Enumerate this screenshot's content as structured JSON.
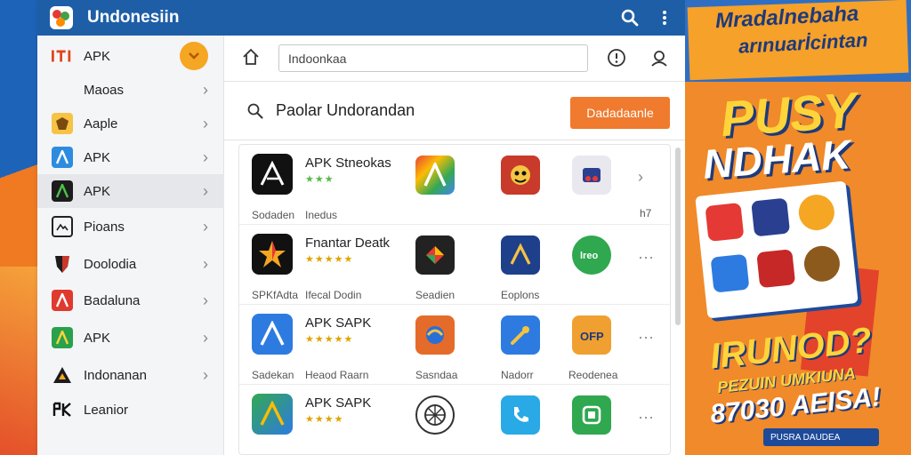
{
  "window": {
    "title": "Undonesiin"
  },
  "toolbar": {
    "address_value": "Indoonkaa"
  },
  "search": {
    "text": "Paolar Undorandan",
    "button_label": "Dadadaanle"
  },
  "sidebar": {
    "items": [
      {
        "label": "APK"
      },
      {
        "label": "Maoas"
      },
      {
        "label": "Aaple"
      },
      {
        "label": "APK"
      },
      {
        "label": "APK"
      },
      {
        "label": "Pioans"
      },
      {
        "label": "Doolodia"
      },
      {
        "label": "Badaluna"
      },
      {
        "label": "APK"
      },
      {
        "label": "Indonanan"
      },
      {
        "label": "Leanior"
      }
    ]
  },
  "rows": [
    {
      "title": "APK Stneokas",
      "stars": "★★★",
      "captions": [
        "Sodaden",
        "Inedus"
      ],
      "count": "h7"
    },
    {
      "title": "Fnantar Deatk",
      "stars": "★★★★★",
      "captions": [
        "SPKfAdta",
        "Ifecal Dodin",
        "Seadien",
        "Eoplons"
      ]
    },
    {
      "title": "APK SAPK",
      "stars": "★★★★★",
      "captions": [
        "Sadekan",
        "Heaod Raarn",
        "Sasndaa",
        "Nadorr",
        "Reodenea"
      ]
    },
    {
      "title": "APK SAPK",
      "stars": "★★★★"
    }
  ],
  "promo": {
    "headline_1": "Mradalnebaha",
    "headline_2": "arınuarİcintan",
    "big_1": "PUSY",
    "big_2": "NDHAK",
    "big_3": "IRUNOD?",
    "sub": "PEZUIN UMKIUNA",
    "big_4": "87030 AEISA!",
    "footer": "PUSRA DAUDEA"
  },
  "colors": {
    "titlebar": "#1e5ea6",
    "accent": "#f07a2e",
    "promo_yellow": "#ffd43a"
  }
}
